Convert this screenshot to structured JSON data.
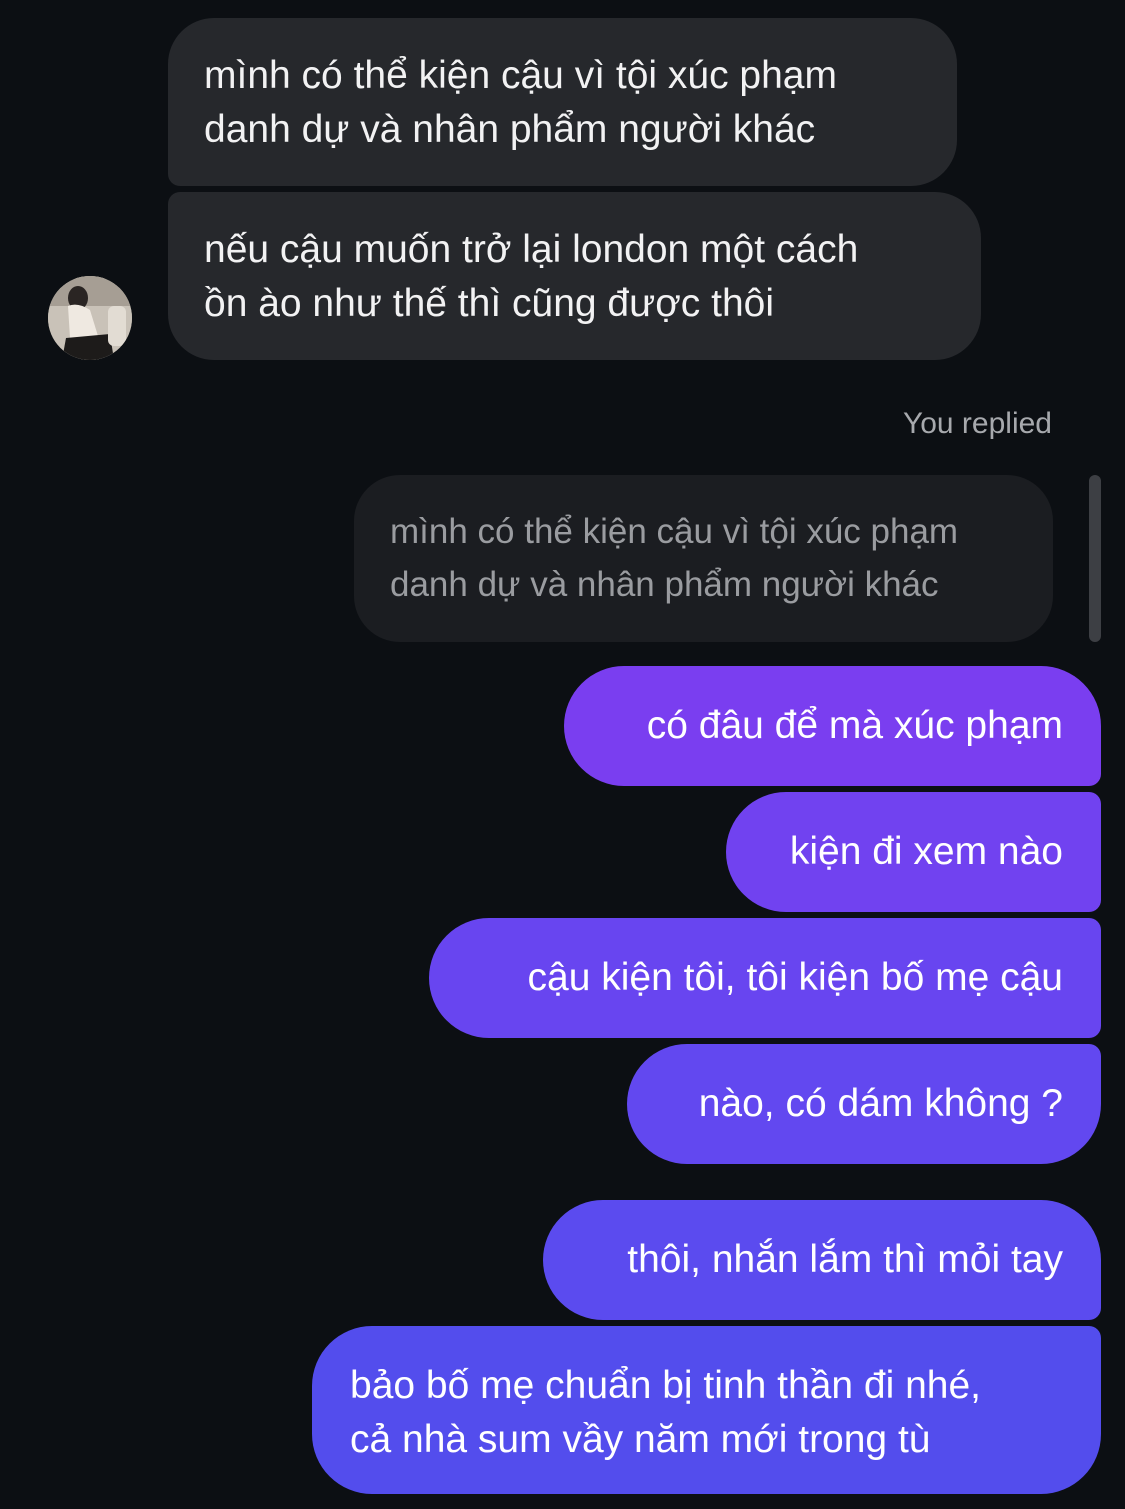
{
  "messages": {
    "incoming": [
      {
        "lines": [
          "mình có thể kiện cậu vì tội xúc phạm",
          "danh dự và nhân phẩm người khác"
        ]
      },
      {
        "lines": [
          "nếu cậu muốn trở lại london một cách",
          "ồn ào như thế thì cũng được thôi"
        ]
      }
    ],
    "reply_context": {
      "label": "You replied",
      "quoted_lines": [
        "mình có thể kiện cậu vì tội xúc phạm",
        "danh dự và nhân phẩm người khác"
      ]
    },
    "outgoing": [
      {
        "lines": [
          "có đâu để mà xúc phạm"
        ]
      },
      {
        "lines": [
          "kiện đi xem nào"
        ]
      },
      {
        "lines": [
          "cậu kiện tôi, tôi kiện bố mẹ cậu"
        ]
      },
      {
        "lines": [
          "nào, có dám không ?"
        ]
      },
      {
        "lines": [
          "thôi, nhắn lắm thì mỏi tay"
        ]
      },
      {
        "lines": [
          "bảo bố mẹ chuẩn bị tinh thần đi nhé,",
          "cả nhà sum vầy năm mới trong tù"
        ]
      }
    ]
  },
  "colors": {
    "background": "#0c0f13",
    "incoming_bubble": "#26282c",
    "outgoing_gradient_top": "#7a3ef0",
    "outgoing_gradient_bottom": "#534ded"
  },
  "icons": {
    "avatar": "contact-avatar-photo"
  }
}
